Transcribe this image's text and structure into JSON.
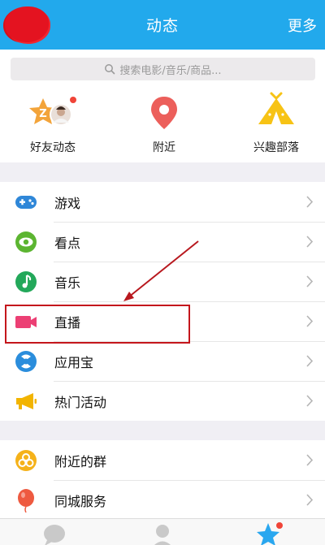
{
  "header": {
    "title": "动态",
    "more_label": "更多"
  },
  "search": {
    "placeholder": "搜索电影/音乐/商品..."
  },
  "quick_actions": [
    {
      "label": "好友动态",
      "icon": "friends-feed-icon"
    },
    {
      "label": "附近",
      "icon": "location-pin-icon"
    },
    {
      "label": "兴趣部落",
      "icon": "tent-icon"
    }
  ],
  "list1": [
    {
      "label": "游戏",
      "icon": "gamepad-icon",
      "color": "#2f87d8"
    },
    {
      "label": "看点",
      "icon": "eye-icon",
      "color": "#5cb531"
    },
    {
      "label": "音乐",
      "icon": "music-note-icon",
      "color": "#23a85a"
    },
    {
      "label": "直播",
      "icon": "video-camera-icon",
      "color": "#ec3f74"
    },
    {
      "label": "应用宝",
      "icon": "app-store-icon",
      "color": "#2a8ddc"
    },
    {
      "label": "热门活动",
      "icon": "megaphone-icon",
      "color": "#f2b400"
    }
  ],
  "list2": [
    {
      "label": "附近的群",
      "icon": "nearby-groups-icon",
      "color": "#f5b21a"
    },
    {
      "label": "同城服务",
      "icon": "balloon-icon",
      "color": "#ee5a40"
    }
  ],
  "tabs": [
    {
      "name": "messages",
      "icon": "chat-bubble-icon"
    },
    {
      "name": "contacts",
      "icon": "person-icon"
    },
    {
      "name": "dynamics",
      "icon": "star-icon"
    }
  ],
  "colors": {
    "header": "#22a9ec",
    "highlight": "#c4161c"
  }
}
